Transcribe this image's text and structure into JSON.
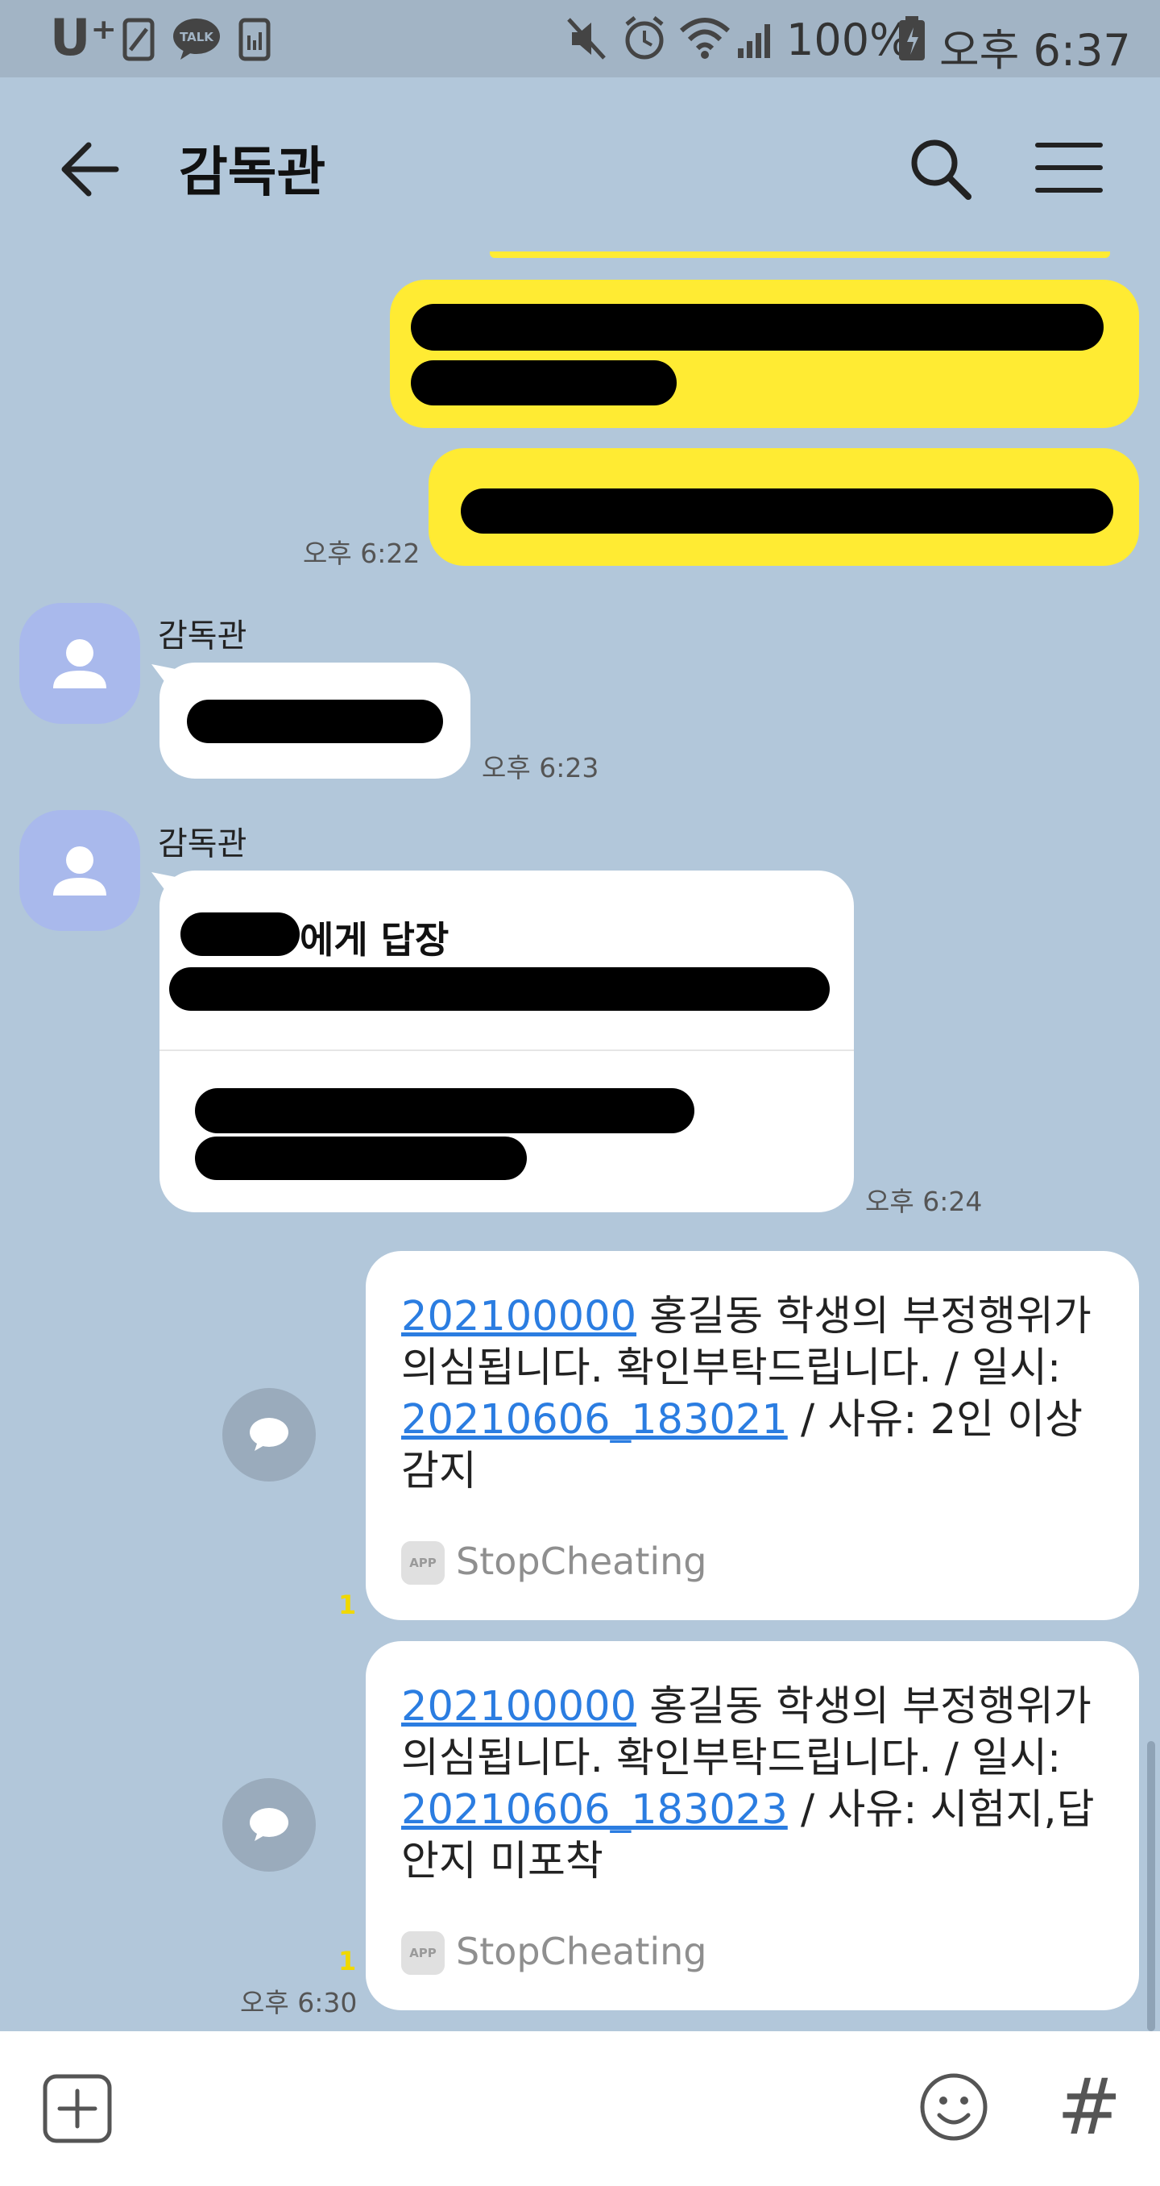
{
  "status_bar": {
    "carrier": "U⁺",
    "battery_text": "100%",
    "time": "오후 6:37"
  },
  "header": {
    "title": "감독관"
  },
  "messages": {
    "sent_time_1": "오후 6:22",
    "msg2": {
      "sender": "감독관",
      "time": "오후 6:23"
    },
    "msg3": {
      "sender": "감독관",
      "reply_suffix": "에게 답장",
      "time": "오후 6:24"
    },
    "card1": {
      "link1": "202100000",
      "text1": " 홍길동 학생의 부정행위가 의심됩니다. 확인부탁드립니다. / 일시: ",
      "link2": "20210606_183021",
      "text2": " / 사유: 2인 이상 감지",
      "app_badge": "APP",
      "app_name": "StopCheating",
      "unread": "1"
    },
    "card2": {
      "link1": "202100000",
      "text1": " 홍길동 학생의 부정행위가 의심됩니다. 확인부탁드립니다. / 일시: ",
      "link2": "20210606_183023",
      "text2": " / 사유: 시험지,답안지 미포착",
      "app_badge": "APP",
      "app_name": "StopCheating",
      "unread": "1",
      "time": "오후 6:30"
    }
  },
  "input_bar": {
    "hash_label": "#"
  },
  "icons": {
    "back": "back-arrow-icon",
    "search": "search-icon",
    "menu": "menu-icon",
    "add": "plus-box-icon",
    "emoji": "emoji-icon",
    "share": "share-chat-icon"
  },
  "colors": {
    "background": "#b2c7da",
    "my_bubble": "#ffeb33",
    "link": "#2b7de1"
  }
}
